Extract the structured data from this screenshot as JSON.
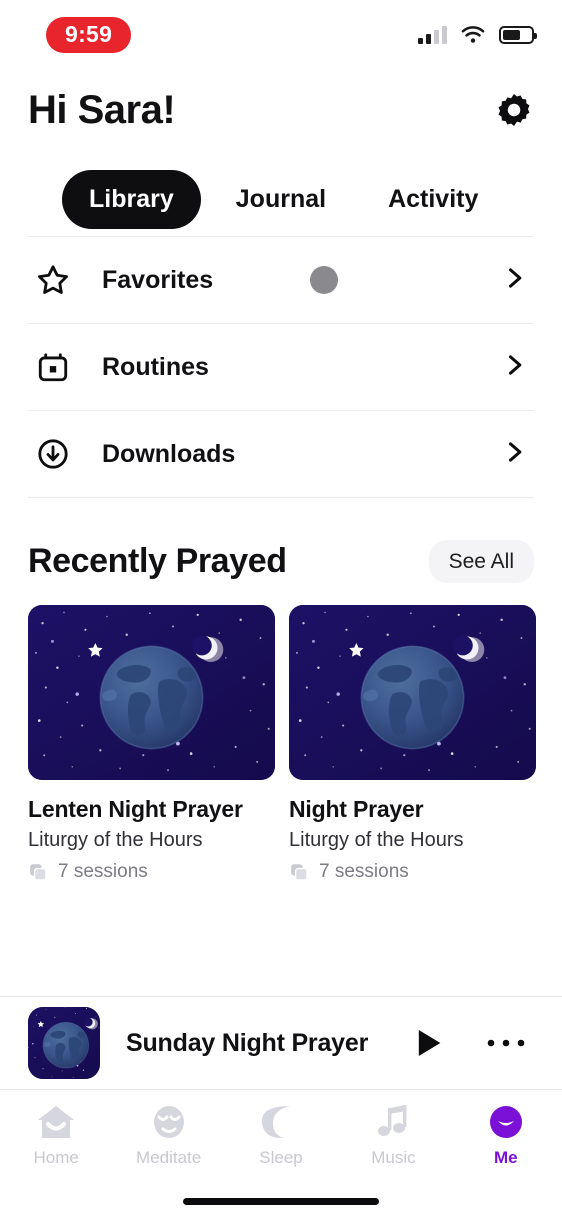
{
  "status_bar": {
    "time": "9:59",
    "signal_icon": "cellular-signal-icon",
    "wifi_icon": "wifi-icon",
    "battery_icon": "battery-icon",
    "battery_level": 62
  },
  "header": {
    "greeting": "Hi Sara!",
    "settings_icon": "gear-icon"
  },
  "tabs": [
    {
      "label": "Library",
      "active": true
    },
    {
      "label": "Journal",
      "active": false
    },
    {
      "label": "Activity",
      "active": false
    }
  ],
  "library_rows": [
    {
      "label": "Favorites",
      "icon": "star-icon",
      "chevron": "chevron-right-icon"
    },
    {
      "label": "Routines",
      "icon": "calendar-icon",
      "chevron": "chevron-right-icon"
    },
    {
      "label": "Downloads",
      "icon": "download-circle-icon",
      "chevron": "chevron-right-icon"
    }
  ],
  "recently_prayed": {
    "title": "Recently Prayed",
    "see_all_label": "See All",
    "cards": [
      {
        "title": "Lenten Night Prayer",
        "subtitle": "Liturgy of the Hours",
        "sessions": "7 sessions",
        "sessions_icon": "layers-icon",
        "artwork": "night-sky-earth-moon"
      },
      {
        "title": "Night Prayer",
        "subtitle": "Liturgy of the Hours",
        "sessions": "7 sessions",
        "sessions_icon": "layers-icon",
        "artwork": "night-sky-earth-moon"
      }
    ]
  },
  "mini_player": {
    "title": "Sunday Night Prayer",
    "thumbnail": "night-sky-earth-moon",
    "play_icon": "play-icon",
    "more_icon": "more-horizontal-icon"
  },
  "bottom_nav": [
    {
      "label": "Home",
      "icon": "home-icon",
      "active": false
    },
    {
      "label": "Meditate",
      "icon": "meditate-face-icon",
      "active": false
    },
    {
      "label": "Sleep",
      "icon": "moon-icon",
      "active": false
    },
    {
      "label": "Music",
      "icon": "music-note-icon",
      "active": false
    },
    {
      "label": "Me",
      "icon": "profile-face-icon",
      "active": true
    }
  ],
  "colors": {
    "accent": "#7b10d6",
    "time_pill": "#e8242c",
    "text_primary": "#111114",
    "text_muted": "#7c7c84",
    "artwork_background": "#1a1060",
    "cursor_dot": "#8a8a8e"
  }
}
